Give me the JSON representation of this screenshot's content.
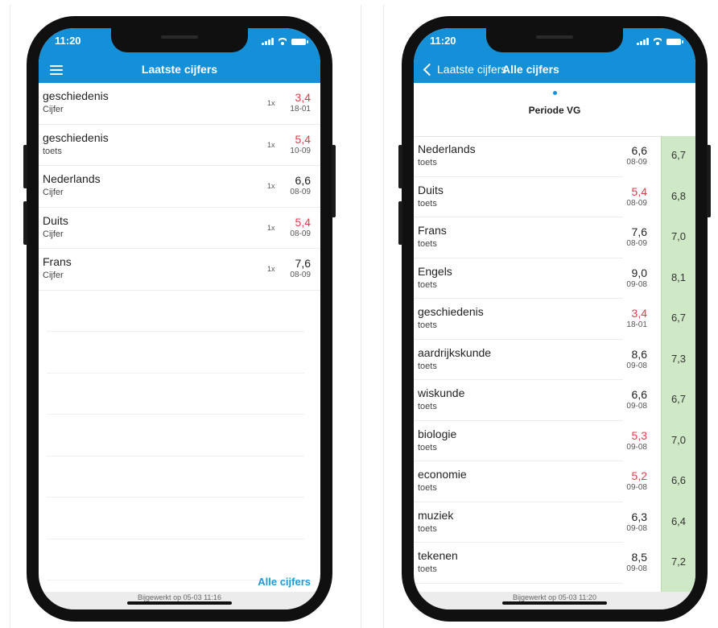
{
  "left_phone": {
    "time": "11:20",
    "title": "Laatste cijfers",
    "items": [
      {
        "subject": "geschiedenis",
        "type": "Cijfer",
        "weight": "1x",
        "grade": "3,4",
        "date": "18-01",
        "insufficient": true
      },
      {
        "subject": "geschiedenis",
        "type": "toets",
        "weight": "1x",
        "grade": "5,4",
        "date": "10-09",
        "insufficient": true
      },
      {
        "subject": "Nederlands",
        "type": "Cijfer",
        "weight": "1x",
        "grade": "6,6",
        "date": "08-09",
        "insufficient": false
      },
      {
        "subject": "Duits",
        "type": "Cijfer",
        "weight": "1x",
        "grade": "5,4",
        "date": "08-09",
        "insufficient": true
      },
      {
        "subject": "Frans",
        "type": "Cijfer",
        "weight": "1x",
        "grade": "7,6",
        "date": "08-09",
        "insufficient": false
      }
    ],
    "link": "Alle cijfers",
    "footer": "Bijgewerkt op 05-03 11:16"
  },
  "right_phone": {
    "time": "11:20",
    "back_label": "Laatste cijfers",
    "title": "Alle cijfers",
    "period": "Periode VG",
    "items": [
      {
        "subject": "Nederlands",
        "type": "toets",
        "grade": "6,6",
        "date": "08-09",
        "average": "6,7",
        "insufficient": false
      },
      {
        "subject": "Duits",
        "type": "toets",
        "grade": "5,4",
        "date": "08-09",
        "average": "6,8",
        "insufficient": true
      },
      {
        "subject": "Frans",
        "type": "toets",
        "grade": "7,6",
        "date": "08-09",
        "average": "7,0",
        "insufficient": false
      },
      {
        "subject": "Engels",
        "type": "toets",
        "grade": "9,0",
        "date": "09-08",
        "average": "8,1",
        "insufficient": false
      },
      {
        "subject": "geschiedenis",
        "type": "toets",
        "grade": "3,4",
        "date": "18-01",
        "average": "6,7",
        "insufficient": true
      },
      {
        "subject": "aardrijkskunde",
        "type": "toets",
        "grade": "8,6",
        "date": "09-08",
        "average": "7,3",
        "insufficient": false
      },
      {
        "subject": "wiskunde",
        "type": "toets",
        "grade": "6,6",
        "date": "09-08",
        "average": "6,7",
        "insufficient": false
      },
      {
        "subject": "biologie",
        "type": "toets",
        "grade": "5,3",
        "date": "09-08",
        "average": "7,0",
        "insufficient": true
      },
      {
        "subject": "economie",
        "type": "toets",
        "grade": "5,2",
        "date": "09-08",
        "average": "6,6",
        "insufficient": true
      },
      {
        "subject": "muziek",
        "type": "toets",
        "grade": "6,3",
        "date": "09-08",
        "average": "6,4",
        "insufficient": false
      },
      {
        "subject": "tekenen",
        "type": "toets",
        "grade": "8,5",
        "date": "09-08",
        "average": "7,2",
        "insufficient": false
      }
    ],
    "footer": "Bijgewerkt op 05-03 11:20"
  },
  "colors": {
    "header": "#1490d8",
    "insufficient": "#e03c4b",
    "link": "#1a9ad8",
    "average_column": "#cfe8c6"
  },
  "icons": {
    "menu": "hamburger-menu-icon",
    "back": "chevron-left-icon",
    "signal": "cellular-signal-icon",
    "wifi": "wifi-icon",
    "battery": "battery-icon"
  }
}
